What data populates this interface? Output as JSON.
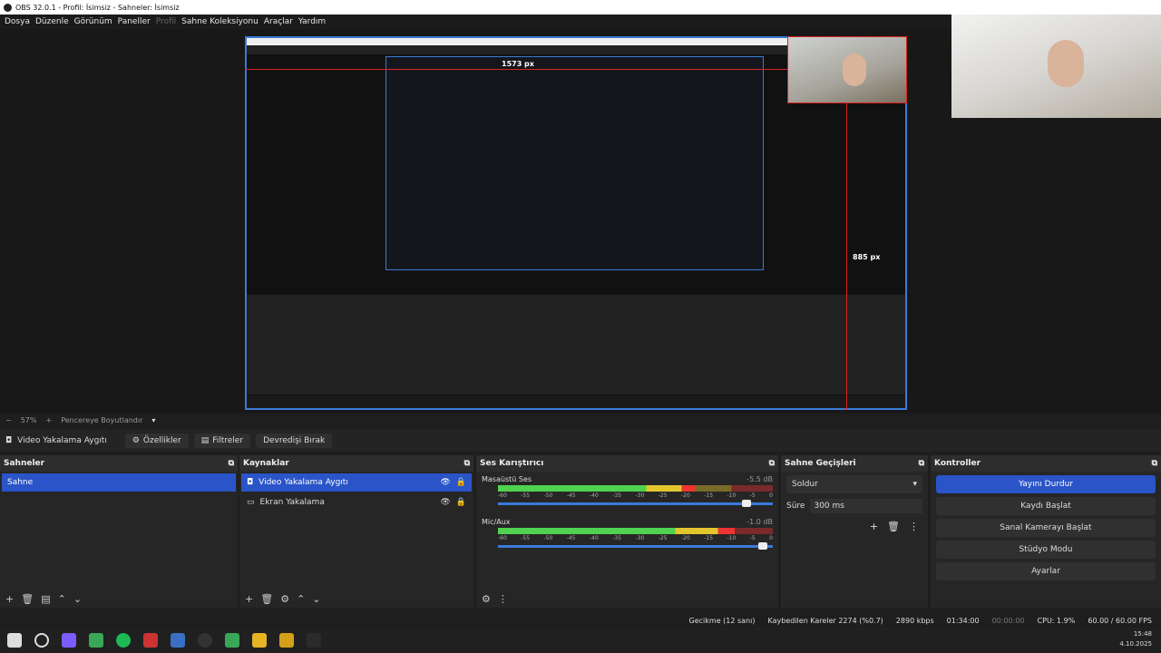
{
  "window": {
    "title": "OBS 32.0.1 - Profil: İsimsiz - Sahneler: İsimsiz"
  },
  "menu": [
    "Dosya",
    "Düzenle",
    "Görünüm",
    "Paneller",
    "Profil",
    "Sahne Koleksiyonu",
    "Araçlar",
    "Yardım"
  ],
  "preview": {
    "label_top": "1573 px",
    "label_side": "885 px"
  },
  "zoom": {
    "value": "57%",
    "fit_label": "Pencereye Boyutlandır"
  },
  "toolbar": {
    "source_name": "Video Yakalama Aygıtı",
    "properties": "Özellikler",
    "filters": "Filtreler",
    "deactivate": "Devredişi Bırak"
  },
  "scenes": {
    "title": "Sahneler",
    "items": [
      "Sahne"
    ]
  },
  "sources": {
    "title": "Kaynaklar",
    "items": [
      "Video Yakalama Aygıtı",
      "Ekran Yakalama"
    ]
  },
  "mixer": {
    "title": "Ses Karıştırıcı",
    "channels": [
      {
        "name": "Masaüstü Ses",
        "db": "-5.5 dB",
        "level": 0.72,
        "volume": 0.92
      },
      {
        "name": "Mic/Aux",
        "db": "-1.0 dB",
        "level": 0.86,
        "volume": 0.98
      }
    ],
    "ticks": [
      "-60",
      "-55",
      "-50",
      "-45",
      "-40",
      "-35",
      "-30",
      "-25",
      "-20",
      "-15",
      "-10",
      "-5",
      "0"
    ]
  },
  "transitions": {
    "title": "Sahne Geçişleri",
    "type": "Soldur",
    "duration_label": "Süre",
    "duration_value": "300 ms"
  },
  "controls": {
    "title": "Kontroller",
    "stream": "Yayını Durdur",
    "record": "Kaydı Başlat",
    "virtualcam": "Sanal Kamerayı Başlat",
    "studio": "Stüdyo Modu",
    "settings": "Ayarlar"
  },
  "status": {
    "latency": "Gecikme (12 sanı)",
    "dropped": "Kaybedilen Kareler 2274 (%0.7)",
    "bitrate": "2890 kbps",
    "stream_time": "01:34:00",
    "rec_time": "00:00:00",
    "cpu": "CPU: 1.9%",
    "fps": "60.00 / 60.00 FPS"
  },
  "clock": {
    "time": "15:48",
    "date": "4.10.2025"
  },
  "colors": {
    "accent": "#2a54c8",
    "marker": "#dd2222"
  }
}
